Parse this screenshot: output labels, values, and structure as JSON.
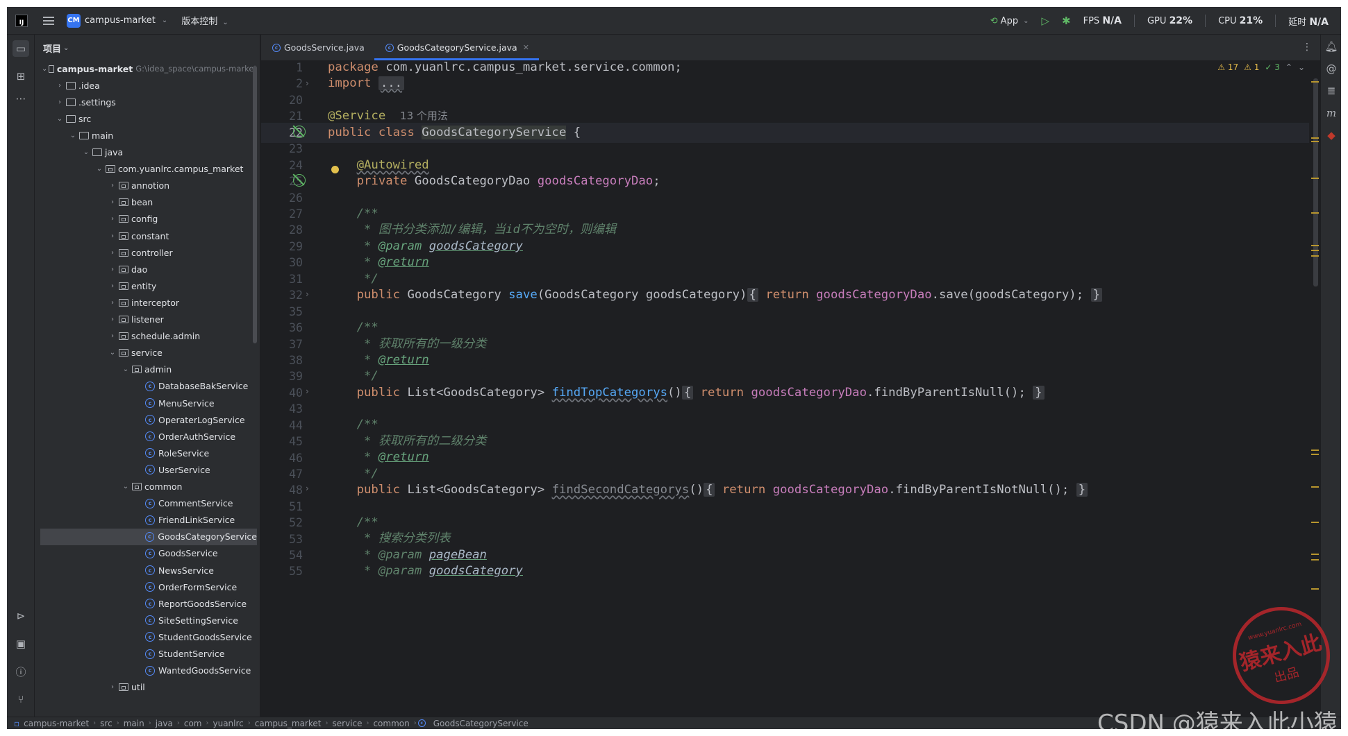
{
  "titlebar": {
    "project_badge": "CM",
    "project_name": "campus-market",
    "vcs_label": "版本控制",
    "run_config": "App",
    "fps_label": "FPS",
    "fps_value": "N/A",
    "gpu_label": "GPU",
    "gpu_value": "22%",
    "cpu_label": "CPU",
    "cpu_value": "21%",
    "latency_label": "延时",
    "latency_value": "N/A"
  },
  "project_panel": {
    "title": "项目",
    "root_name": "campus-market",
    "root_path": "G:\\idea_space\\campus-market",
    "tree": [
      {
        "label": ".idea",
        "depth": 1,
        "kind": "folder",
        "state": "collapsed"
      },
      {
        "label": ".settings",
        "depth": 1,
        "kind": "folder",
        "state": "collapsed"
      },
      {
        "label": "src",
        "depth": 1,
        "kind": "folder",
        "state": "expanded"
      },
      {
        "label": "main",
        "depth": 2,
        "kind": "folder",
        "state": "expanded"
      },
      {
        "label": "java",
        "depth": 3,
        "kind": "folder",
        "state": "expanded"
      },
      {
        "label": "com.yuanlrc.campus_market",
        "depth": 4,
        "kind": "package",
        "state": "expanded"
      },
      {
        "label": "annotion",
        "depth": 5,
        "kind": "package",
        "state": "collapsed"
      },
      {
        "label": "bean",
        "depth": 5,
        "kind": "package",
        "state": "collapsed"
      },
      {
        "label": "config",
        "depth": 5,
        "kind": "package",
        "state": "collapsed"
      },
      {
        "label": "constant",
        "depth": 5,
        "kind": "package",
        "state": "collapsed"
      },
      {
        "label": "controller",
        "depth": 5,
        "kind": "package",
        "state": "collapsed"
      },
      {
        "label": "dao",
        "depth": 5,
        "kind": "package",
        "state": "collapsed"
      },
      {
        "label": "entity",
        "depth": 5,
        "kind": "package",
        "state": "collapsed"
      },
      {
        "label": "interceptor",
        "depth": 5,
        "kind": "package",
        "state": "collapsed"
      },
      {
        "label": "listener",
        "depth": 5,
        "kind": "package",
        "state": "collapsed"
      },
      {
        "label": "schedule.admin",
        "depth": 5,
        "kind": "package",
        "state": "collapsed"
      },
      {
        "label": "service",
        "depth": 5,
        "kind": "package",
        "state": "expanded"
      },
      {
        "label": "admin",
        "depth": 6,
        "kind": "package",
        "state": "expanded"
      },
      {
        "label": "DatabaseBakService",
        "depth": 7,
        "kind": "class"
      },
      {
        "label": "MenuService",
        "depth": 7,
        "kind": "class"
      },
      {
        "label": "OperaterLogService",
        "depth": 7,
        "kind": "class"
      },
      {
        "label": "OrderAuthService",
        "depth": 7,
        "kind": "class"
      },
      {
        "label": "RoleService",
        "depth": 7,
        "kind": "class"
      },
      {
        "label": "UserService",
        "depth": 7,
        "kind": "class"
      },
      {
        "label": "common",
        "depth": 6,
        "kind": "package",
        "state": "expanded"
      },
      {
        "label": "CommentService",
        "depth": 7,
        "kind": "class"
      },
      {
        "label": "FriendLinkService",
        "depth": 7,
        "kind": "class"
      },
      {
        "label": "GoodsCategoryService",
        "depth": 7,
        "kind": "class",
        "selected": true
      },
      {
        "label": "GoodsService",
        "depth": 7,
        "kind": "class"
      },
      {
        "label": "NewsService",
        "depth": 7,
        "kind": "class"
      },
      {
        "label": "OrderFormService",
        "depth": 7,
        "kind": "class"
      },
      {
        "label": "ReportGoodsService",
        "depth": 7,
        "kind": "class"
      },
      {
        "label": "SiteSettingService",
        "depth": 7,
        "kind": "class"
      },
      {
        "label": "StudentGoodsService",
        "depth": 7,
        "kind": "class"
      },
      {
        "label": "StudentService",
        "depth": 7,
        "kind": "class"
      },
      {
        "label": "WantedGoodsService",
        "depth": 7,
        "kind": "class"
      },
      {
        "label": "util",
        "depth": 5,
        "kind": "package",
        "state": "collapsed"
      }
    ]
  },
  "editor": {
    "tabs": [
      {
        "label": "GoodsService.java",
        "active": false
      },
      {
        "label": "GoodsCategoryService.java",
        "active": true
      }
    ],
    "inspections": {
      "warnings": "17",
      "weak_warnings": "1",
      "ok": "3"
    },
    "line_numbers": [
      "1",
      "2",
      "20",
      "21",
      "22",
      "23",
      "24",
      "25",
      "26",
      "27",
      "28",
      "29",
      "30",
      "31",
      "32",
      "35",
      "36",
      "37",
      "38",
      "39",
      "40",
      "43",
      "44",
      "45",
      "46",
      "47",
      "48",
      "51",
      "52",
      "53",
      "54",
      "55"
    ],
    "current_line": "22",
    "code": {
      "l1_kw": "package",
      "l1_rest": " com.yuanlrc.campus_market.service.common;",
      "l2_kw": "import",
      "l2_fold": "...",
      "l21_ann": "@Service",
      "l21_hint": "13 个用法",
      "l22_kw": "public class ",
      "l22_name": "GoodsCategoryService",
      "l22_rest": " {",
      "l24_ann": "@Autowired",
      "l25_kw": "private ",
      "l25_type": "GoodsCategoryDao ",
      "l25_field": "goodsCategoryDao",
      "l25_end": ";",
      "doc_open": "/**",
      "doc_close": "*/",
      "doc_star": "* ",
      "tag_param": "@param",
      "tag_return": "@return",
      "l28_text": "图书分类添加/编辑，当id不为空时，则编辑",
      "l29_param": "goodsCategory",
      "l32_kw": "public ",
      "l32_type": "GoodsCategory ",
      "l32_method": "save",
      "l32_args": "(GoodsCategory goodsCategory)",
      "l32_ret": "return ",
      "l32_field": "goodsCategoryDao",
      "l32_call": ".save(goodsCategory);",
      "l37_text": "获取所有的一级分类",
      "l40_type": "List<GoodsCategory> ",
      "l40_method": "findTopCategorys",
      "l40_args": "()",
      "l40_call": ".findByParentIsNull();",
      "l45_text": "获取所有的二级分类",
      "l48_method": "findSecondCategorys",
      "l48_call": ".findByParentIsNotNull();",
      "l53_text": "搜索分类列表",
      "l54_param": "pageBean",
      "l55_param": "goodsCategory",
      "fold_open": "{",
      "fold_close": "}"
    }
  },
  "statusbar": {
    "breadcrumbs": [
      "campus-market",
      "src",
      "main",
      "java",
      "com",
      "yuanlrc",
      "campus_market",
      "service",
      "common",
      "GoodsCategoryService"
    ]
  },
  "watermark": {
    "stamp_url": "www.yuanlrc.com",
    "stamp_main": "猿来入此",
    "stamp_sub": "出品",
    "csdn": "CSDN @猿来入此小猿"
  },
  "colors": {
    "accent": "#3574f0",
    "keyword": "#cf8e6d",
    "annotation": "#b3ae60",
    "field": "#c77dbb",
    "method": "#56a8f5",
    "doc_comment": "#5f826b",
    "background": "#1e1f22",
    "panel": "#2b2d30"
  },
  "icons": [
    "hamburger-menu-icon",
    "folder-icon",
    "structure-icon",
    "more-icon",
    "run-icon",
    "debug-icon",
    "terminal-icon",
    "problems-icon",
    "git-icon",
    "notifications-icon",
    "ai-assistant-icon",
    "database-icon",
    "maven-icon"
  ]
}
